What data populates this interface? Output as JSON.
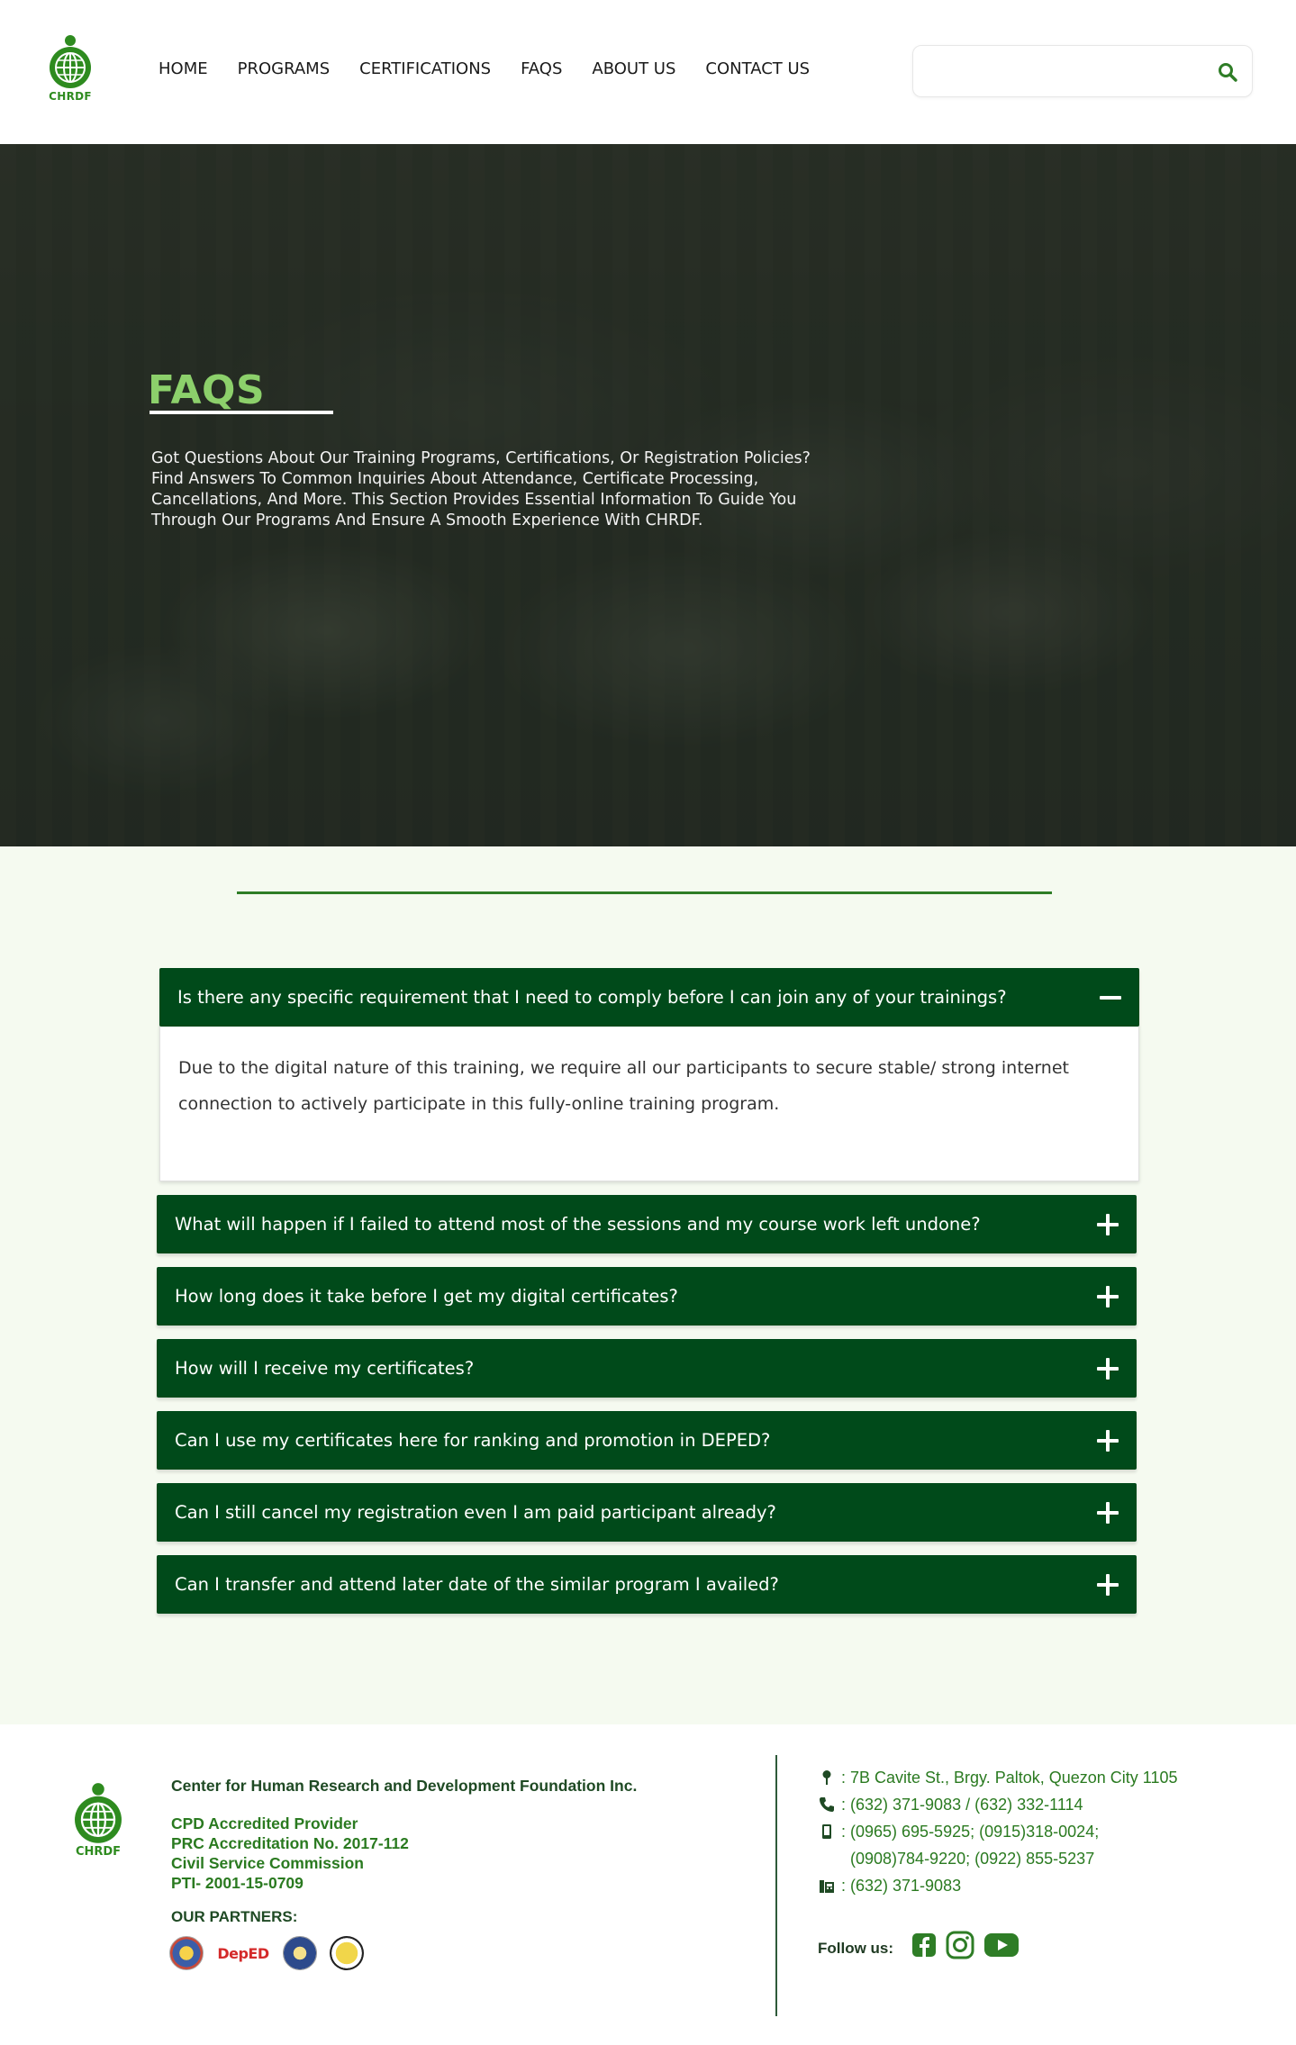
{
  "header": {
    "logo_text": "CHRDF",
    "nav": [
      "HOME",
      "PROGRAMS",
      "CERTIFICATIONS",
      "FAQS",
      "ABOUT US",
      "CONTACT US"
    ],
    "search": {
      "value": "",
      "placeholder": ""
    }
  },
  "hero": {
    "title": "FAQS",
    "description": "Got Questions About Our Training Programs, Certifications, Or Registration Policies? Find Answers To Common Inquiries About Attendance, Certificate Processing, Cancellations, And More. This Section Provides Essential Information To Guide You Through Our Programs And Ensure A Smooth Experience With CHRDF."
  },
  "faq": {
    "items": [
      {
        "question": "Is there any specific requirement that I need to comply before I can join any of your trainings?",
        "answer": "Due to the digital nature of this training, we require all our participants to secure stable/ strong internet connection to actively participate in this fully-online training program.",
        "expanded": true
      },
      {
        "question": "What will happen if I failed to attend most of the sessions and my course work left undone?",
        "expanded": false
      },
      {
        "question": "How long does it take before I get my digital certificates?",
        "expanded": false
      },
      {
        "question": "How will I receive my certificates?",
        "expanded": false
      },
      {
        "question": "Can I use my certificates here for ranking and promotion in DEPED?",
        "expanded": false
      },
      {
        "question": "Can I still cancel my registration even I am paid participant already?",
        "expanded": false
      },
      {
        "question": "Can I transfer and attend later date of the similar program I availed?",
        "expanded": false
      }
    ]
  },
  "footer": {
    "logo_text": "CHRDF",
    "org_name": "Center for Human Research and Development Foundation Inc.",
    "credentials": [
      "CPD Accredited Provider",
      "PRC Accreditation No. 2017-112",
      "Civil Service Commission",
      "PTI- 2001-15-0709"
    ],
    "partners_label": "OUR PARTNERS:",
    "partner_deped": "DepED",
    "contact": {
      "address": ": 7B Cavite St., Brgy. Paltok, Quezon City 1105",
      "phone": ": (632) 371-9083 / (632) 332-1114",
      "mobile_line1": ": (0965) 695-5925; (0915)318-0024;",
      "mobile_line2": "(0908)784-9220; (0922) 855-5237",
      "fax": ": (632) 371-9083"
    },
    "follow_label": "Follow us:",
    "socials": [
      "facebook-icon",
      "instagram-icon",
      "youtube-icon"
    ]
  },
  "colors": {
    "brand_green": "#2e8b1f",
    "faq_header": "#004a1a",
    "hero_title": "#8cd06b",
    "section_bg": "#f5faf0"
  }
}
